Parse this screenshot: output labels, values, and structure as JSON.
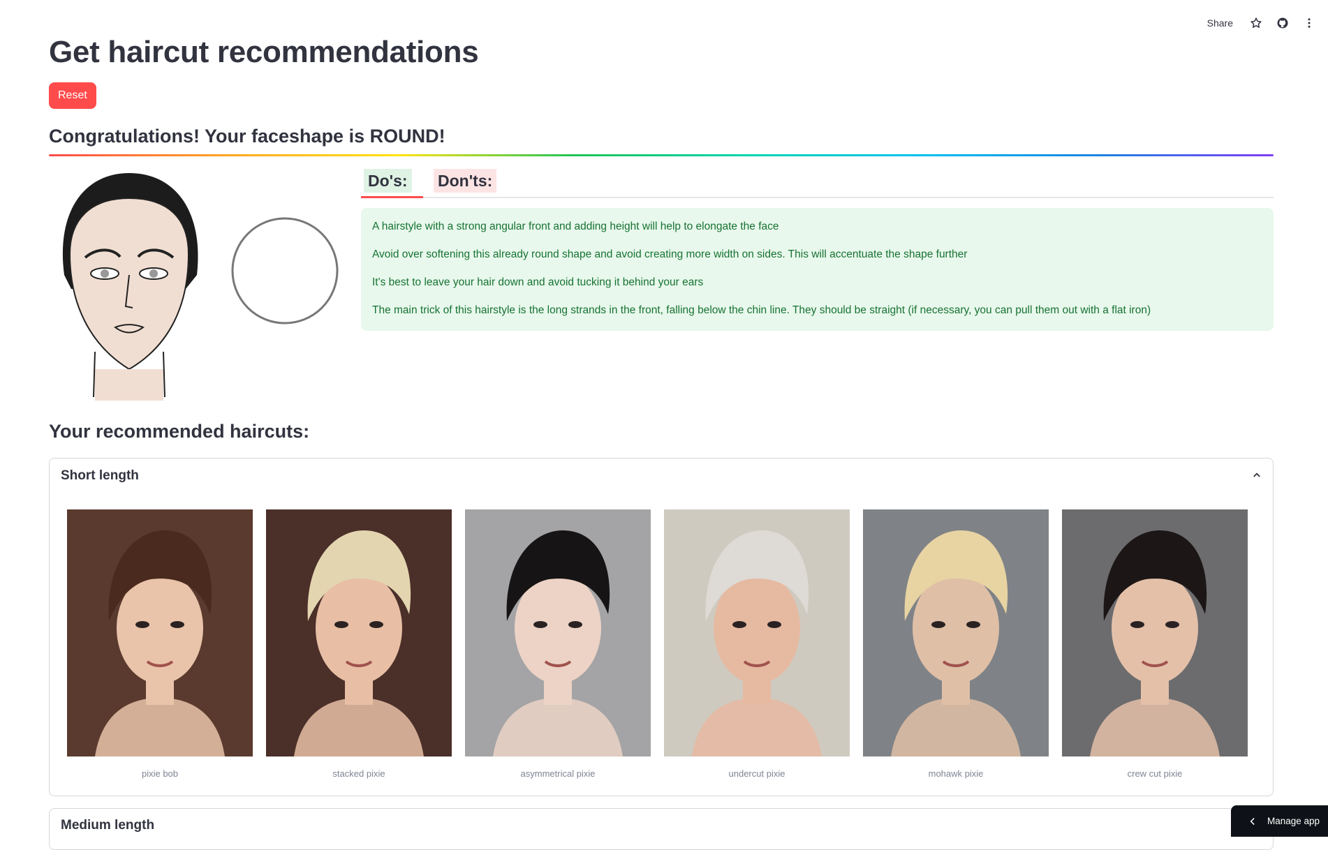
{
  "toolbar": {
    "share_label": "Share",
    "icons": [
      "star-icon",
      "github-icon",
      "more-vertical-icon"
    ]
  },
  "page": {
    "title": "Get haircut recommendations",
    "reset_label": "Reset",
    "result_heading": "Congratulations! Your faceshape is ROUND!",
    "recommended_heading": "Your recommended haircuts:"
  },
  "tabs": [
    {
      "label": "Do's:",
      "selected": true
    },
    {
      "label": "Don'ts:",
      "selected": false
    }
  ],
  "dos": [
    "A hairstyle with a strong angular front and adding height will help to elongate the face",
    "Avoid over softening this already round shape and avoid creating more width on sides. This will accentuate the shape further",
    "It's best to leave your hair down and avoid tucking it behind your ears",
    "The main trick of this hairstyle is the long strands in the front, falling below the chin line. They should be straight (if necessary, you can pull them out with a flat iron)"
  ],
  "sections": [
    {
      "title": "Short length",
      "expanded": true,
      "haircuts": [
        {
          "caption": "pixie bob",
          "bg": "#5a3a2e",
          "hair": "#4a2a1e",
          "skin": "#e9c4aa"
        },
        {
          "caption": "stacked pixie",
          "bg": "#4b2f29",
          "hair": "#e3d5b0",
          "skin": "#e8bfa5"
        },
        {
          "caption": "asymmetrical pixie",
          "bg": "#a4a4a6",
          "hair": "#161414",
          "skin": "#ecd3c5"
        },
        {
          "caption": "undercut pixie",
          "bg": "#cfcac0",
          "hair": "#dedad5",
          "skin": "#e6b9a1"
        },
        {
          "caption": "mohawk pixie",
          "bg": "#7f8387",
          "hair": "#e8d3a2",
          "skin": "#dfbfa6"
        },
        {
          "caption": "crew cut pixie",
          "bg": "#6c6c6e",
          "hair": "#1c1616",
          "skin": "#e4c0a9"
        }
      ]
    },
    {
      "title": "Medium length",
      "expanded": false
    }
  ],
  "manage_app_label": "Manage app",
  "colors": {
    "accent": "#ff4b4b",
    "success_bg": "#e8f8ec",
    "success_text": "#177233"
  }
}
